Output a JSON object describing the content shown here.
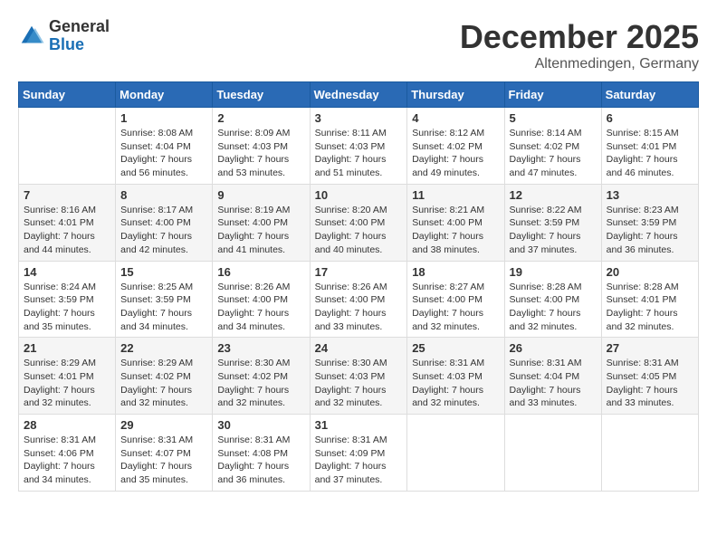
{
  "logo": {
    "general": "General",
    "blue": "Blue"
  },
  "header": {
    "month": "December 2025",
    "location": "Altenmedingen, Germany"
  },
  "weekdays": [
    "Sunday",
    "Monday",
    "Tuesday",
    "Wednesday",
    "Thursday",
    "Friday",
    "Saturday"
  ],
  "weeks": [
    [
      {
        "day": "",
        "info": ""
      },
      {
        "day": "1",
        "info": "Sunrise: 8:08 AM\nSunset: 4:04 PM\nDaylight: 7 hours\nand 56 minutes."
      },
      {
        "day": "2",
        "info": "Sunrise: 8:09 AM\nSunset: 4:03 PM\nDaylight: 7 hours\nand 53 minutes."
      },
      {
        "day": "3",
        "info": "Sunrise: 8:11 AM\nSunset: 4:03 PM\nDaylight: 7 hours\nand 51 minutes."
      },
      {
        "day": "4",
        "info": "Sunrise: 8:12 AM\nSunset: 4:02 PM\nDaylight: 7 hours\nand 49 minutes."
      },
      {
        "day": "5",
        "info": "Sunrise: 8:14 AM\nSunset: 4:02 PM\nDaylight: 7 hours\nand 47 minutes."
      },
      {
        "day": "6",
        "info": "Sunrise: 8:15 AM\nSunset: 4:01 PM\nDaylight: 7 hours\nand 46 minutes."
      }
    ],
    [
      {
        "day": "7",
        "info": "Sunrise: 8:16 AM\nSunset: 4:01 PM\nDaylight: 7 hours\nand 44 minutes."
      },
      {
        "day": "8",
        "info": "Sunrise: 8:17 AM\nSunset: 4:00 PM\nDaylight: 7 hours\nand 42 minutes."
      },
      {
        "day": "9",
        "info": "Sunrise: 8:19 AM\nSunset: 4:00 PM\nDaylight: 7 hours\nand 41 minutes."
      },
      {
        "day": "10",
        "info": "Sunrise: 8:20 AM\nSunset: 4:00 PM\nDaylight: 7 hours\nand 40 minutes."
      },
      {
        "day": "11",
        "info": "Sunrise: 8:21 AM\nSunset: 4:00 PM\nDaylight: 7 hours\nand 38 minutes."
      },
      {
        "day": "12",
        "info": "Sunrise: 8:22 AM\nSunset: 3:59 PM\nDaylight: 7 hours\nand 37 minutes."
      },
      {
        "day": "13",
        "info": "Sunrise: 8:23 AM\nSunset: 3:59 PM\nDaylight: 7 hours\nand 36 minutes."
      }
    ],
    [
      {
        "day": "14",
        "info": "Sunrise: 8:24 AM\nSunset: 3:59 PM\nDaylight: 7 hours\nand 35 minutes."
      },
      {
        "day": "15",
        "info": "Sunrise: 8:25 AM\nSunset: 3:59 PM\nDaylight: 7 hours\nand 34 minutes."
      },
      {
        "day": "16",
        "info": "Sunrise: 8:26 AM\nSunset: 4:00 PM\nDaylight: 7 hours\nand 34 minutes."
      },
      {
        "day": "17",
        "info": "Sunrise: 8:26 AM\nSunset: 4:00 PM\nDaylight: 7 hours\nand 33 minutes."
      },
      {
        "day": "18",
        "info": "Sunrise: 8:27 AM\nSunset: 4:00 PM\nDaylight: 7 hours\nand 32 minutes."
      },
      {
        "day": "19",
        "info": "Sunrise: 8:28 AM\nSunset: 4:00 PM\nDaylight: 7 hours\nand 32 minutes."
      },
      {
        "day": "20",
        "info": "Sunrise: 8:28 AM\nSunset: 4:01 PM\nDaylight: 7 hours\nand 32 minutes."
      }
    ],
    [
      {
        "day": "21",
        "info": "Sunrise: 8:29 AM\nSunset: 4:01 PM\nDaylight: 7 hours\nand 32 minutes."
      },
      {
        "day": "22",
        "info": "Sunrise: 8:29 AM\nSunset: 4:02 PM\nDaylight: 7 hours\nand 32 minutes."
      },
      {
        "day": "23",
        "info": "Sunrise: 8:30 AM\nSunset: 4:02 PM\nDaylight: 7 hours\nand 32 minutes."
      },
      {
        "day": "24",
        "info": "Sunrise: 8:30 AM\nSunset: 4:03 PM\nDaylight: 7 hours\nand 32 minutes."
      },
      {
        "day": "25",
        "info": "Sunrise: 8:31 AM\nSunset: 4:03 PM\nDaylight: 7 hours\nand 32 minutes."
      },
      {
        "day": "26",
        "info": "Sunrise: 8:31 AM\nSunset: 4:04 PM\nDaylight: 7 hours\nand 33 minutes."
      },
      {
        "day": "27",
        "info": "Sunrise: 8:31 AM\nSunset: 4:05 PM\nDaylight: 7 hours\nand 33 minutes."
      }
    ],
    [
      {
        "day": "28",
        "info": "Sunrise: 8:31 AM\nSunset: 4:06 PM\nDaylight: 7 hours\nand 34 minutes."
      },
      {
        "day": "29",
        "info": "Sunrise: 8:31 AM\nSunset: 4:07 PM\nDaylight: 7 hours\nand 35 minutes."
      },
      {
        "day": "30",
        "info": "Sunrise: 8:31 AM\nSunset: 4:08 PM\nDaylight: 7 hours\nand 36 minutes."
      },
      {
        "day": "31",
        "info": "Sunrise: 8:31 AM\nSunset: 4:09 PM\nDaylight: 7 hours\nand 37 minutes."
      },
      {
        "day": "",
        "info": ""
      },
      {
        "day": "",
        "info": ""
      },
      {
        "day": "",
        "info": ""
      }
    ]
  ]
}
